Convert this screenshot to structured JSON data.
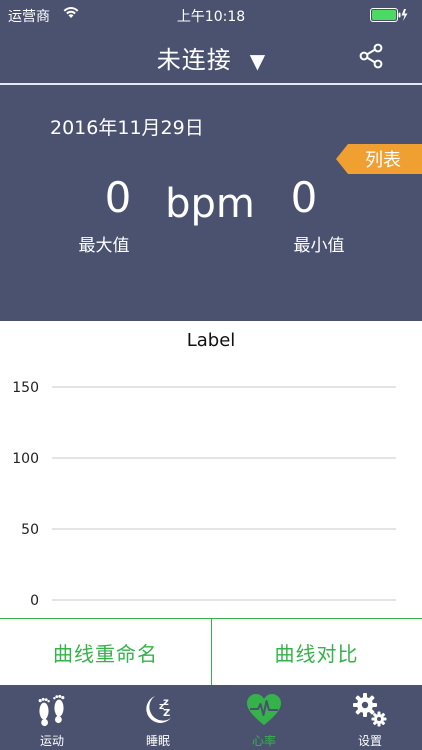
{
  "status_bar": {
    "carrier": "运营商",
    "time": "上午10:18"
  },
  "nav": {
    "title": "未连接",
    "caret": "▼",
    "share_icon": "share-icon"
  },
  "summary": {
    "date": "2016年11月29日",
    "list_tag": "列表",
    "max_value": "0",
    "unit": "bpm",
    "min_value": "0",
    "max_label": "最大值",
    "min_label": "最小值"
  },
  "chart_data": {
    "type": "line",
    "title": "Label",
    "ylim": [
      0,
      150
    ],
    "y_ticks": [
      0,
      50,
      100,
      150
    ],
    "y_tick_labels": [
      "0",
      "50",
      "100",
      "150"
    ],
    "grid": true,
    "series": [
      {
        "values": []
      }
    ]
  },
  "actions": {
    "rename": "曲线重命名",
    "compare": "曲线对比"
  },
  "tabbar": {
    "items": [
      {
        "label": "运动",
        "icon": "footprints-icon"
      },
      {
        "label": "睡眠",
        "icon": "moon-sleep-icon"
      },
      {
        "label": "心率",
        "icon": "heart-rate-icon"
      },
      {
        "label": "设置",
        "icon": "gears-icon"
      }
    ],
    "active_index": 2
  },
  "colors": {
    "header_bg": "#4a5270",
    "accent_green": "#35b34a",
    "tag_orange": "#f0a030",
    "battery_green": "#4cd964"
  }
}
